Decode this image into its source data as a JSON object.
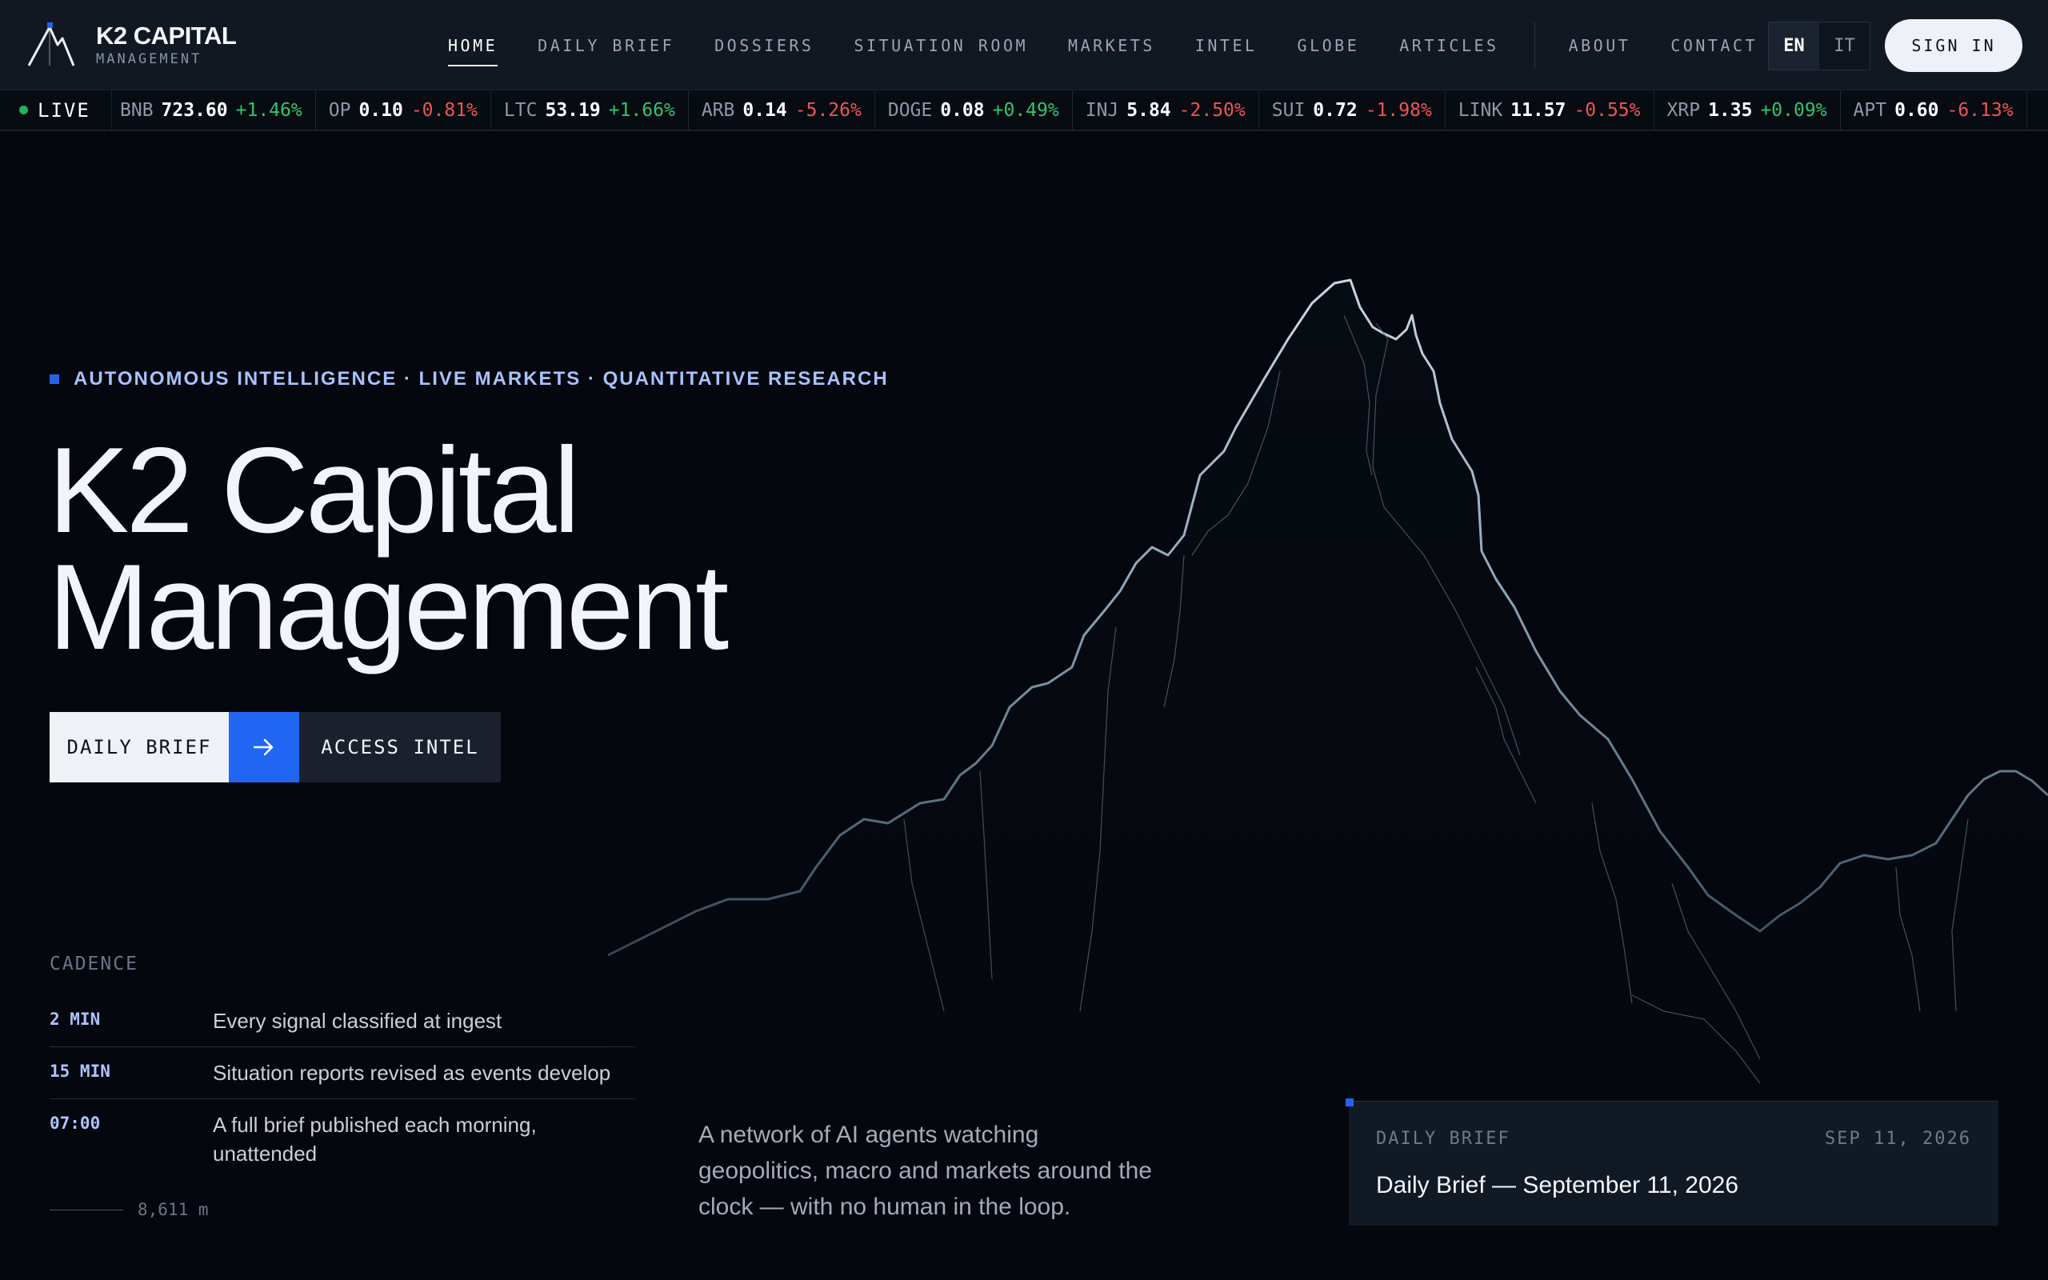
{
  "brand": {
    "name": "K2 CAPITAL",
    "sub": "MANAGEMENT"
  },
  "nav": {
    "items": [
      {
        "label": "HOME",
        "active": true
      },
      {
        "label": "DAILY BRIEF"
      },
      {
        "label": "DOSSIERS"
      },
      {
        "label": "SITUATION ROOM"
      },
      {
        "label": "MARKETS"
      },
      {
        "label": "INTEL"
      },
      {
        "label": "GLOBE"
      },
      {
        "label": "ARTICLES"
      }
    ],
    "secondary": [
      {
        "label": "ABOUT"
      },
      {
        "label": "CONTACT"
      }
    ],
    "lang": {
      "en": "EN",
      "it": "IT",
      "selected": "EN"
    },
    "signin": "SIGN IN"
  },
  "ticker": {
    "live_label": "LIVE",
    "items": [
      {
        "sym": "BNB",
        "price": "723.60",
        "change": "+1.46%",
        "dir": "up"
      },
      {
        "sym": "OP",
        "price": "0.10",
        "change": "-0.81%",
        "dir": "dn"
      },
      {
        "sym": "LTC",
        "price": "53.19",
        "change": "+1.66%",
        "dir": "up"
      },
      {
        "sym": "ARB",
        "price": "0.14",
        "change": "-5.26%",
        "dir": "dn"
      },
      {
        "sym": "DOGE",
        "price": "0.08",
        "change": "+0.49%",
        "dir": "up"
      },
      {
        "sym": "INJ",
        "price": "5.84",
        "change": "-2.50%",
        "dir": "dn"
      },
      {
        "sym": "SUI",
        "price": "0.72",
        "change": "-1.98%",
        "dir": "dn"
      },
      {
        "sym": "LINK",
        "price": "11.57",
        "change": "-0.55%",
        "dir": "dn"
      },
      {
        "sym": "XRP",
        "price": "1.35",
        "change": "+0.09%",
        "dir": "up"
      },
      {
        "sym": "APT",
        "price": "0.60",
        "change": "-6.13%",
        "dir": "dn"
      }
    ]
  },
  "hero": {
    "eyebrow": "AUTONOMOUS INTELLIGENCE · LIVE MARKETS · QUANTITATIVE RESEARCH",
    "title_line1": "K2 Capital",
    "title_line2": "Management",
    "cta_primary": "DAILY BRIEF",
    "cta_secondary": "ACCESS INTEL",
    "tagline": "A network of AI agents watching geopolitics, macro and markets around the clock — with no human in the loop."
  },
  "cadence": {
    "label": "CADENCE",
    "rows": [
      {
        "key": "2 MIN",
        "value": "Every signal classified at ingest"
      },
      {
        "key": "15 MIN",
        "value": "Situation reports revised as events develop"
      },
      {
        "key": "07:00",
        "value": "A full brief published each morning, unattended"
      }
    ],
    "altitude": "8,611 m"
  },
  "brief_card": {
    "kicker": "DAILY BRIEF",
    "date": "SEP 11, 2026",
    "title": "Daily Brief — September 11, 2026"
  },
  "colors": {
    "accent": "#2563eb",
    "up": "#33c46b",
    "down": "#ef5454",
    "background": "#04070d"
  }
}
